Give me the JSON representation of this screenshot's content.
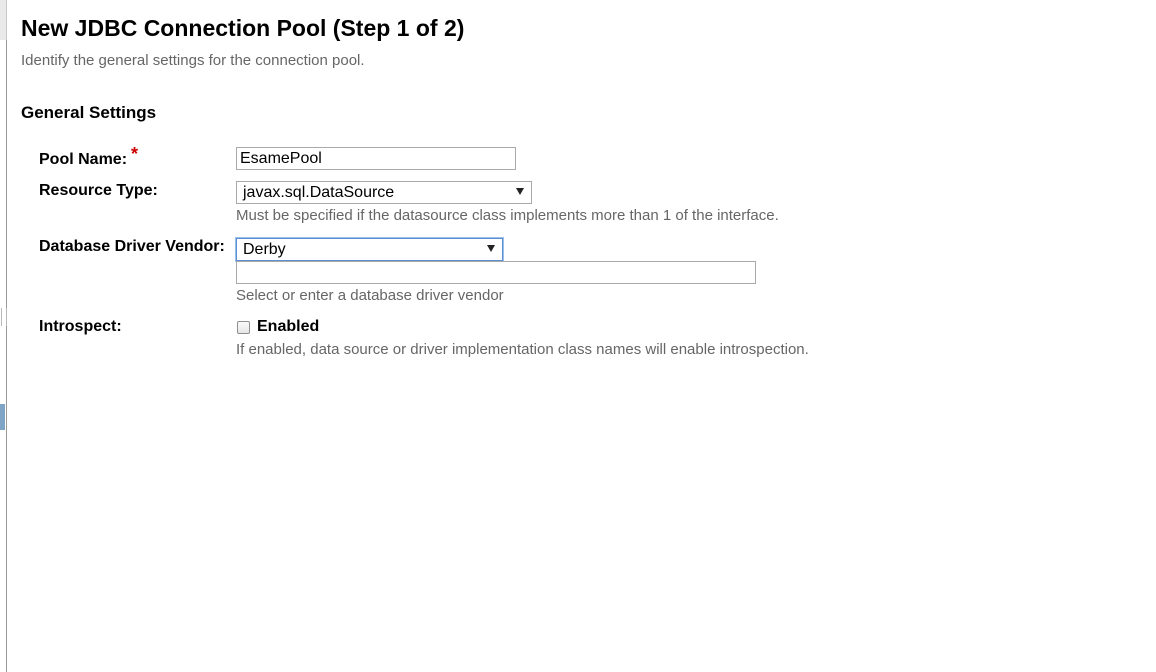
{
  "header": {
    "title": "New JDBC Connection Pool (Step 1 of 2)",
    "help": "Identify the general settings for the connection pool."
  },
  "section": {
    "title": "General Settings"
  },
  "fields": {
    "pool_name": {
      "label": "Pool Name:",
      "required_marker": "*",
      "value": "EsamePool"
    },
    "resource_type": {
      "label": "Resource Type:",
      "selected": "javax.sql.DataSource",
      "help": "Must be specified if the datasource class implements more than 1 of the interface."
    },
    "db_vendor": {
      "label": "Database Driver Vendor:",
      "selected": "Derby",
      "custom_value": "",
      "help": "Select or enter a database driver vendor"
    },
    "introspect": {
      "label": "Introspect:",
      "checkbox_label": "Enabled",
      "checked": false,
      "help": "If enabled, data source or driver implementation class names will enable introspection."
    }
  },
  "icons": {
    "dropdown": "chevron-down-icon",
    "required": "asterisk-icon"
  },
  "colors": {
    "required": "#cc0000",
    "focus_border": "#5b8fd4",
    "help_text": "#666666"
  }
}
